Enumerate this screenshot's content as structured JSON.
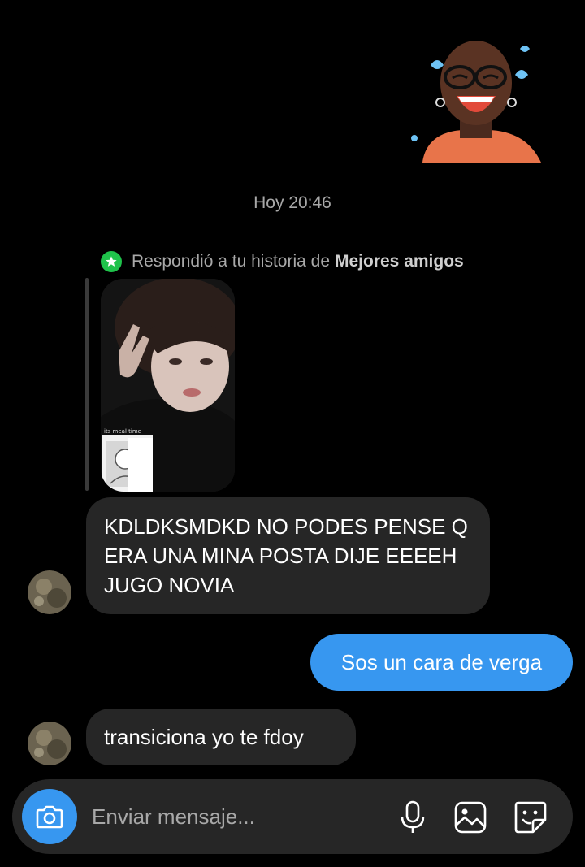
{
  "conversation": {
    "timestamp": "Hoy 20:46",
    "story_reply": {
      "prefix": "Respondió a tu historia de",
      "audience": "Mejores amigos",
      "thumb_overlay_text": "its meal time"
    },
    "messages": [
      {
        "sender": "them",
        "text": "KDLDKSMDKD NO PODES PENSE Q ERA UNA MINA POSTA DIJE EEEEH JUGO NOVIA"
      },
      {
        "sender": "me",
        "text": "Sos un cara de verga"
      },
      {
        "sender": "them",
        "text": "transiciona yo te fdoy"
      }
    ]
  },
  "composer": {
    "placeholder": "Enviar mensaje..."
  },
  "colors": {
    "background": "#000000",
    "incoming_bubble": "#262626",
    "outgoing_bubble": "#3797f0",
    "best_friends_badge": "#1fc24b"
  }
}
